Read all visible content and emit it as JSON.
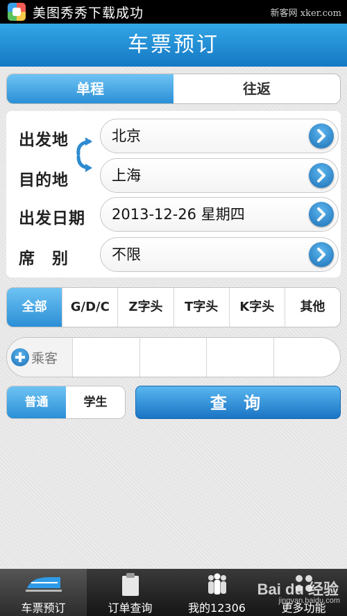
{
  "status_bar": {
    "notification_text": "美图秀秀下载成功",
    "watermark": "新客网 xker.com"
  },
  "header": {
    "title": "车票预订"
  },
  "trip_tabs": [
    {
      "label": "单程",
      "active": true
    },
    {
      "label": "往返",
      "active": false
    }
  ],
  "form": {
    "from": {
      "label": "出发地",
      "value": "北京"
    },
    "to": {
      "label": "目的地",
      "value": "上海"
    },
    "date": {
      "label": "出发日期",
      "value": "2013-12-26 星期四"
    },
    "seat": {
      "label": "席　别",
      "value": "不限"
    }
  },
  "train_types": [
    {
      "label": "全部",
      "active": true
    },
    {
      "label": "G/D/C",
      "active": false
    },
    {
      "label": "Z字头",
      "active": false
    },
    {
      "label": "T字头",
      "active": false
    },
    {
      "label": "K字头",
      "active": false
    },
    {
      "label": "其他",
      "active": false
    }
  ],
  "passenger": {
    "add_label": "乘客"
  },
  "ticket_types": [
    {
      "label": "普通",
      "active": true
    },
    {
      "label": "学生",
      "active": false
    }
  ],
  "query_button": "查 询",
  "bottom_nav": [
    {
      "label": "车票预订",
      "icon": "train-icon",
      "active": true
    },
    {
      "label": "订单查询",
      "icon": "clipboard-icon",
      "active": false
    },
    {
      "label": "我的12306",
      "icon": "people-icon",
      "active": false
    },
    {
      "label": "更多功能",
      "icon": "more-icon",
      "active": false
    }
  ],
  "baidu_watermark": {
    "brand": "Bai du 经验",
    "url": "jingyan.baidu.com"
  },
  "colors": {
    "accent": "#1a74c4",
    "title_bar": "#2a92d6"
  }
}
